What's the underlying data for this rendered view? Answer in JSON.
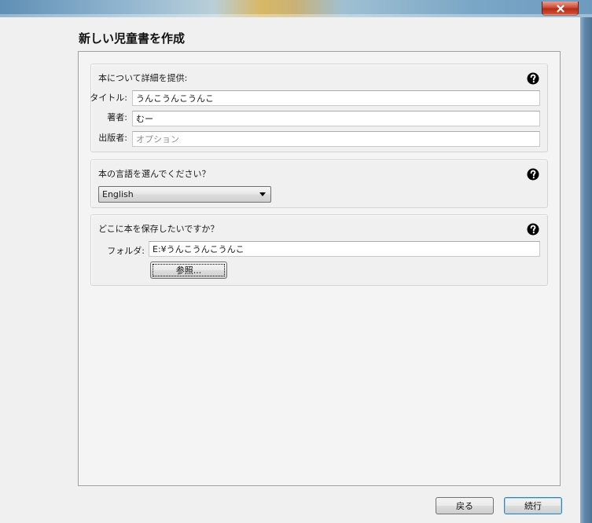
{
  "window": {
    "close_label": "x"
  },
  "page_title": "新しい児童書を作成",
  "details_group": {
    "title": "本について詳細を提供:",
    "help_icon": "question-circle-icon",
    "title_label": "タイトル:",
    "title_value": "うんこうんこうんこ",
    "author_label": "著者:",
    "author_value": "むー",
    "publisher_label": "出版者:",
    "publisher_placeholder": "オプション"
  },
  "language_group": {
    "title": "本の言語を選んでください？",
    "help_icon": "question-circle-icon",
    "selected_language": "English"
  },
  "location_group": {
    "title": "どこに本を保存したいですか？",
    "help_icon": "question-circle-icon",
    "folder_label": "フォルダ:",
    "folder_value": "E:¥うんこうんこうんこ",
    "browse_label": "参照..."
  },
  "footer": {
    "back_label": "戻る",
    "next_label": "続行"
  },
  "colors": {
    "accent_focus": "#3c7fb1",
    "close_red": "#c7432e"
  }
}
